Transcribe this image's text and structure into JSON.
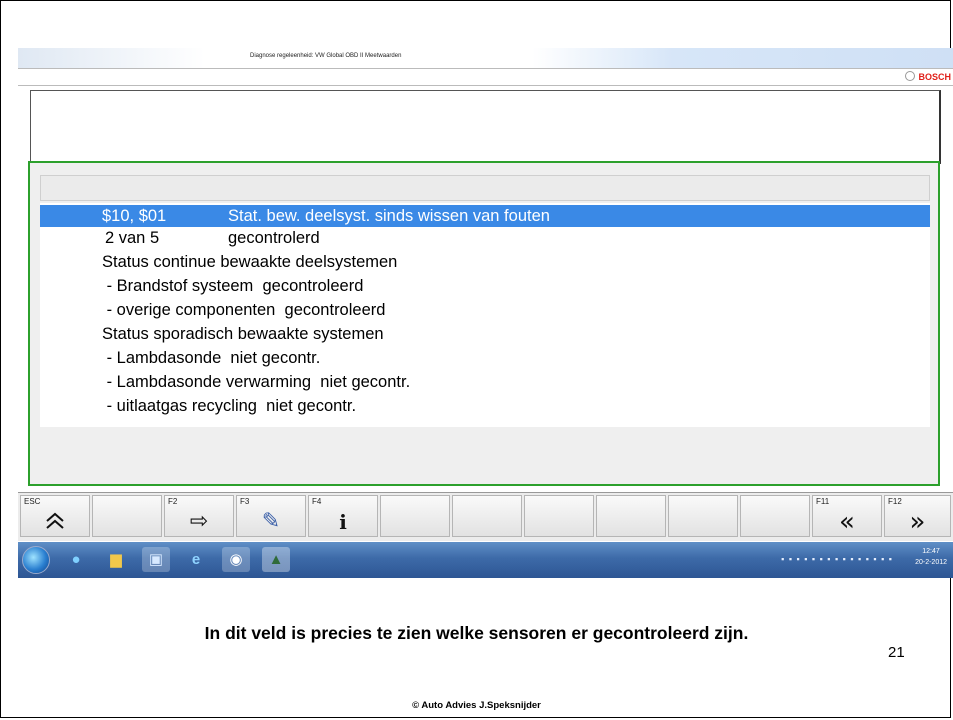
{
  "window": {
    "title": "Diagnose regeleenheid: VW Global OBD II Meetwaarden",
    "brand": "BOSCH"
  },
  "list": {
    "selected_row": {
      "code": "$10, $01",
      "text": "Stat. bew. deelsyst. sinds wissen van fouten"
    },
    "summary_row": {
      "count": "2 van 5",
      "status": "gecontrolerd"
    },
    "lines": [
      "Status continue bewaakte deelsystemen",
      " - Brandstof systeem  gecontroleerd",
      " - overige componenten  gecontroleerd",
      "Status sporadisch bewaakte systemen",
      " - Lambdasonde  niet gecontr.",
      " - Lambdasonde verwarming  niet gecontr.",
      " - uitlaatgas recycling  niet gecontr."
    ]
  },
  "function_keys": [
    {
      "label": "ESC",
      "icon": "double-up-icon",
      "glyph": "≪"
    },
    {
      "label": "",
      "icon": "",
      "glyph": ""
    },
    {
      "label": "F2",
      "icon": "arrow-right-icon",
      "glyph": "⇨"
    },
    {
      "label": "F3",
      "icon": "edit-icon",
      "glyph": "✎"
    },
    {
      "label": "F4",
      "icon": "info-icon",
      "glyph": "i"
    },
    {
      "label": "F11",
      "icon": "double-left-icon",
      "glyph": "«"
    },
    {
      "label": "F12",
      "icon": "double-right-icon",
      "glyph": "»"
    }
  ],
  "taskbar": {
    "clock_time": "12:47",
    "clock_date": "20-2-2012"
  },
  "slide": {
    "caption": "In dit veld is precies te zien welke sensoren er gecontroleerd zijn.",
    "page_number": "21",
    "copyright": "© Auto Advies  J.Speksnijder"
  },
  "colors": {
    "selection": "#3a89e6",
    "panel_border": "#2ca02c",
    "brand": "#e0201a"
  }
}
